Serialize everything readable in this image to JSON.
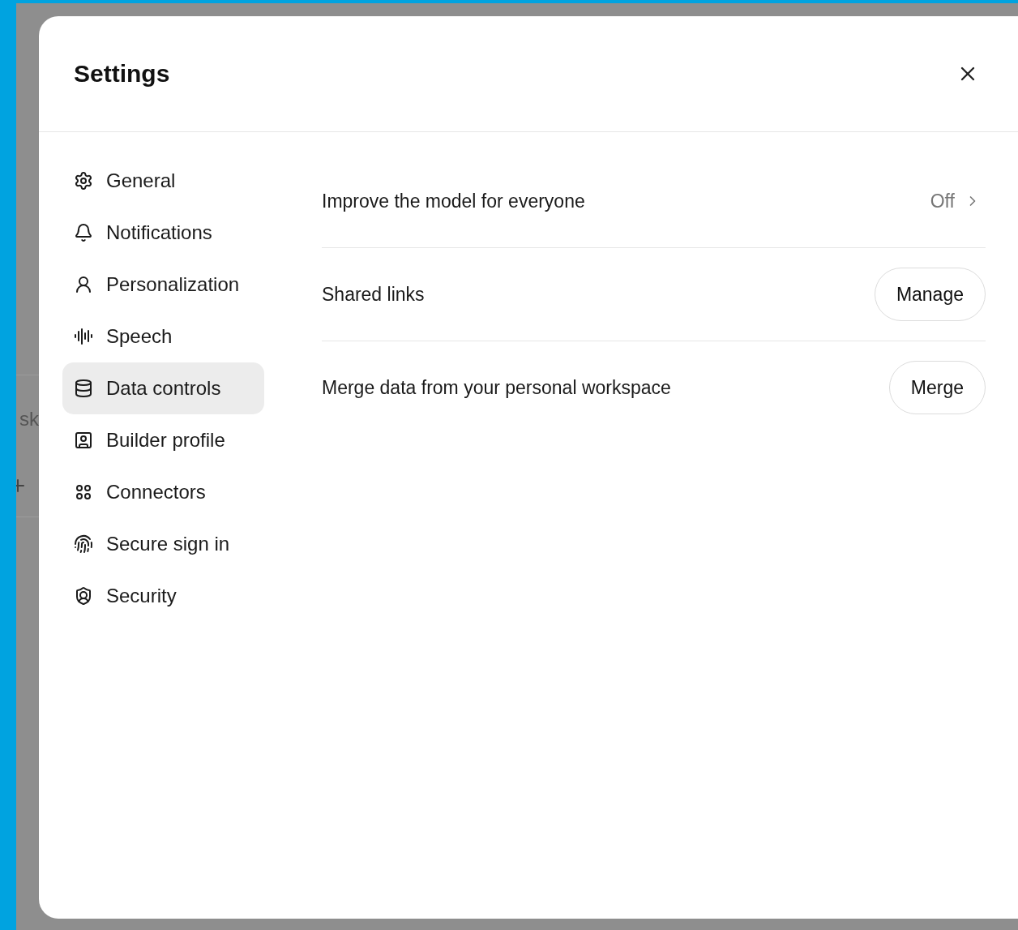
{
  "backdrop": {
    "text": "sk"
  },
  "dialog": {
    "title": "Settings",
    "sidebar": {
      "items": [
        {
          "kind": "general",
          "label": "General",
          "selected": false
        },
        {
          "kind": "notifications",
          "label": "Notifications",
          "selected": false
        },
        {
          "kind": "personalization",
          "label": "Personalization",
          "selected": false
        },
        {
          "kind": "speech",
          "label": "Speech",
          "selected": false
        },
        {
          "kind": "data",
          "label": "Data controls",
          "selected": true
        },
        {
          "kind": "builder",
          "label": "Builder profile",
          "selected": false
        },
        {
          "kind": "connectors",
          "label": "Connectors",
          "selected": false
        },
        {
          "kind": "signin",
          "label": "Secure sign in",
          "selected": false
        },
        {
          "kind": "security",
          "label": "Security",
          "selected": false
        }
      ]
    },
    "rows": [
      {
        "kind": "link",
        "label": "Improve the model for everyone",
        "value": "Off"
      },
      {
        "kind": "button",
        "label": "Shared links",
        "button": "Manage"
      },
      {
        "kind": "button",
        "label": "Merge data from your personal workspace",
        "button": "Merge"
      }
    ]
  }
}
